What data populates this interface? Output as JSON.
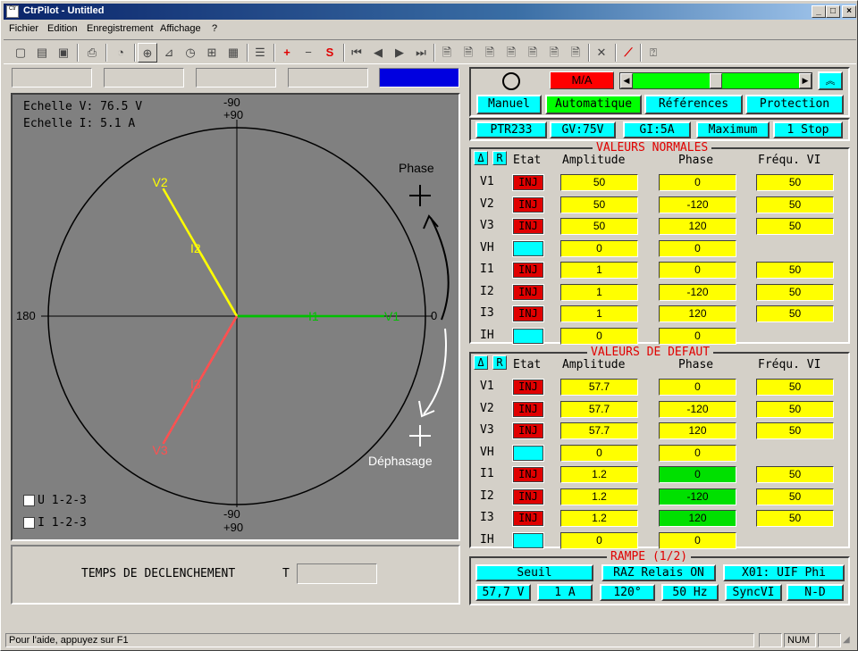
{
  "window": {
    "title": "CtrPilot - Untitled",
    "icon_text": "Ctr"
  },
  "menu": [
    "Fichier",
    "Edition",
    "Enregistrement",
    "Affichage",
    "?"
  ],
  "graph": {
    "scale_v": "Echelle V: 76.5 V",
    "scale_i": "Echelle I: 5.1 A",
    "top_label_1": "-90",
    "top_label_2": "+90",
    "bottom_label_1": "-90",
    "bottom_label_2": "+90",
    "left_label": "180",
    "right_label": "0",
    "phase_label": "Phase",
    "dephasage_label": "Déphasage",
    "vectors": [
      {
        "name": "V1",
        "angle": 0,
        "color": "#00c000"
      },
      {
        "name": "V2",
        "angle": -120,
        "color": "#ffff00"
      },
      {
        "name": "V3",
        "angle": 120,
        "color": "#ff5050"
      },
      {
        "name": "I1",
        "angle": 0,
        "color": "#00c000"
      },
      {
        "name": "I2",
        "angle": -120,
        "color": "#ffff00"
      },
      {
        "name": "I3",
        "angle": 120,
        "color": "#ff5050"
      }
    ],
    "check_u": "U 1-2-3",
    "check_i": "I 1-2-3"
  },
  "temps": {
    "label": "TEMPS DE DECLENCHEMENT",
    "t_label": "T",
    "value": ""
  },
  "control": {
    "ma_label": "M/A",
    "slider_level": 0.5,
    "modes": [
      "Manuel",
      "Automatique",
      "Références",
      "Protection"
    ],
    "info": [
      "PTR233",
      "GV:75V",
      "GI:5A",
      "Maximum",
      "1 Stop"
    ]
  },
  "columns": {
    "delta": "Δ",
    "r": "R",
    "etat": "Etat",
    "amplitude": "Amplitude",
    "phase": "Phase",
    "freq": "Fréqu. VI"
  },
  "normales": {
    "title": "VALEURS NORMALES",
    "rows": [
      {
        "label": "V1",
        "etat": "INJ",
        "amp": "50",
        "phase": "0",
        "freq": "50"
      },
      {
        "label": "V2",
        "etat": "INJ",
        "amp": "50",
        "phase": "-120",
        "freq": "50"
      },
      {
        "label": "V3",
        "etat": "INJ",
        "amp": "50",
        "phase": "120",
        "freq": "50"
      },
      {
        "label": "VH",
        "etat": "",
        "amp": "0",
        "phase": "0",
        "freq": null
      },
      {
        "label": "I1",
        "etat": "INJ",
        "amp": "1",
        "phase": "0",
        "freq": "50"
      },
      {
        "label": "I2",
        "etat": "INJ",
        "amp": "1",
        "phase": "-120",
        "freq": "50"
      },
      {
        "label": "I3",
        "etat": "INJ",
        "amp": "1",
        "phase": "120",
        "freq": "50"
      },
      {
        "label": "IH",
        "etat": "",
        "amp": "0",
        "phase": "0",
        "freq": null
      }
    ]
  },
  "defaut": {
    "title": "VALEURS DE DEFAUT",
    "rows": [
      {
        "label": "V1",
        "etat": "INJ",
        "amp": "57.7",
        "phase": "0",
        "freq": "50",
        "phase_green": false
      },
      {
        "label": "V2",
        "etat": "INJ",
        "amp": "57.7",
        "phase": "-120",
        "freq": "50",
        "phase_green": false
      },
      {
        "label": "V3",
        "etat": "INJ",
        "amp": "57.7",
        "phase": "120",
        "freq": "50",
        "phase_green": false
      },
      {
        "label": "VH",
        "etat": "",
        "amp": "0",
        "phase": "0",
        "freq": null,
        "phase_green": false
      },
      {
        "label": "I1",
        "etat": "INJ",
        "amp": "1.2",
        "phase": "0",
        "freq": "50",
        "phase_green": true
      },
      {
        "label": "I2",
        "etat": "INJ",
        "amp": "1.2",
        "phase": "-120",
        "freq": "50",
        "phase_green": true
      },
      {
        "label": "I3",
        "etat": "INJ",
        "amp": "1.2",
        "phase": "120",
        "freq": "50",
        "phase_green": true
      },
      {
        "label": "IH",
        "etat": "",
        "amp": "0",
        "phase": "0",
        "freq": null,
        "phase_green": false
      }
    ]
  },
  "rampe": {
    "title": "RAMPE (1/2)",
    "row1": [
      "Seuil",
      "RAZ Relais ON",
      "X01: UIF Phi"
    ],
    "row2": [
      "57,7 V",
      "1 A",
      "120°",
      "50 Hz",
      "SyncVI",
      "N-D"
    ]
  },
  "status": {
    "message": "Pour l'aide, appuyez sur F1",
    "num": "NUM"
  }
}
